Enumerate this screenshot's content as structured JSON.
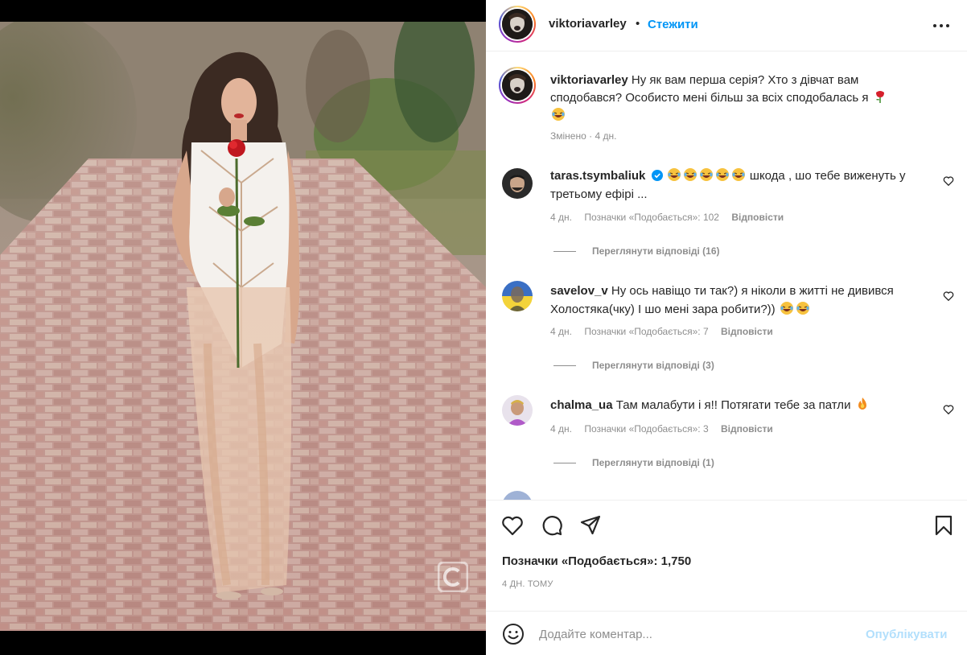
{
  "post": {
    "author": "viktoriavarley",
    "separator": "•",
    "follow_label": "Стежити",
    "more_icon": "more-horizontal-icon"
  },
  "caption": {
    "username": "viktoriavarley",
    "text": "Ну як вам перша серія? Хто з дівчат вам сподобався? Особисто мені більш за всіх сподобалась я",
    "edited": "Змінено",
    "time": "4 дн.",
    "meta_separator": "·"
  },
  "comments": [
    {
      "username": "taras.tsymbaliuk",
      "verified": true,
      "text": "шкода , шо тебе виженуть у третьому ефірі ...",
      "time": "4 дн.",
      "likes": "Позначки «Подобається»: 102",
      "reply_label": "Відповісти",
      "view_replies": "Переглянути відповіді (16)"
    },
    {
      "username": "savelov_v",
      "verified": false,
      "text": "Ну ось навіщо ти так?) я ніколи в житті не дивився Холостяка(чку) І шо мені зара робити?))",
      "time": "4 дн.",
      "likes": "Позначки «Подобається»: 7",
      "reply_label": "Відповісти",
      "view_replies": "Переглянути відповіді (3)"
    },
    {
      "username": "chalma_ua",
      "verified": false,
      "text": "Там малабути і я!! Потягати тебе за патли",
      "time": "4 дн.",
      "likes": "Позначки «Подобається»: 3",
      "reply_label": "Відповісти",
      "view_replies": "Переглянути відповіді (1)"
    }
  ],
  "footer": {
    "likes": "Позначки «Подобається»: 1,750",
    "time_ago": "4 ДН. ТОМУ",
    "comment_placeholder": "Додайте коментар...",
    "post_label": "Опублікувати"
  },
  "colors": {
    "accent": "#0095f6",
    "post_disabled": "#b2dffc",
    "secondary_text": "#8e8e8e"
  }
}
